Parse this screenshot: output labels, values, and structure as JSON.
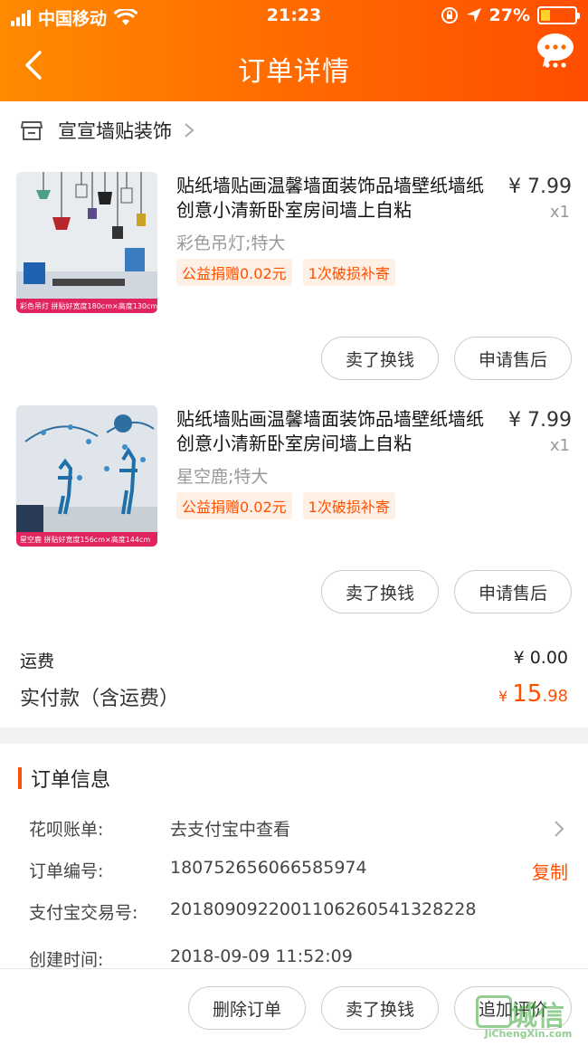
{
  "status_bar": {
    "carrier": "中国移动",
    "time": "21:23",
    "battery_percent": "27%",
    "battery_level": 0.27
  },
  "nav": {
    "title": "订单详情"
  },
  "shop": {
    "name": "宣宣墙贴装饰"
  },
  "items": [
    {
      "title": "贴纸墙贴画温馨墙面装饰品墙壁纸墙纸创意小清新卧室房间墙上自粘",
      "price": "¥ 7.99",
      "qty": "x1",
      "spec": "彩色吊灯;特大",
      "tags": [
        "公益捐赠0.02元",
        "1次破损补寄"
      ],
      "thumb_caption": "彩色吊灯 拼贴好宽度180cm×高度130cm",
      "btn_sell": "卖了换钱",
      "btn_after": "申请售后"
    },
    {
      "title": "贴纸墙贴画温馨墙面装饰品墙壁纸墙纸创意小清新卧室房间墙上自粘",
      "price": "¥ 7.99",
      "qty": "x1",
      "spec": "星空鹿;特大",
      "tags": [
        "公益捐赠0.02元",
        "1次破损补寄"
      ],
      "thumb_caption": "星空鹿 拼贴好宽度156cm×高度144cm",
      "btn_sell": "卖了换钱",
      "btn_after": "申请售后"
    }
  ],
  "summary": {
    "freight_label": "运费",
    "freight_value": "¥ 0.00",
    "paid_label": "实付款（含运费）",
    "paid_currency": "¥ ",
    "paid_int": "15",
    "paid_dec": ".98"
  },
  "order_info": {
    "title": "订单信息",
    "rows": [
      {
        "key": "花呗账单:",
        "value": "去支付宝中查看"
      },
      {
        "key": "订单编号:",
        "value": "180752656066585974",
        "action": "复制"
      },
      {
        "key": "支付宝交易号:",
        "value": "2018090922001106260541328228"
      },
      {
        "key": "创建时间:",
        "value": "2018-09-09 11:52:09"
      }
    ]
  },
  "bottom_bar": {
    "delete": "删除订单",
    "sell": "卖了换钱",
    "review": "追加评价"
  },
  "watermark": {
    "text": "城信",
    "sub": "JiChengXin.com"
  },
  "colors": {
    "accent": "#ff5000",
    "header_start": "#ff8a00",
    "header_end": "#ff4e00"
  }
}
